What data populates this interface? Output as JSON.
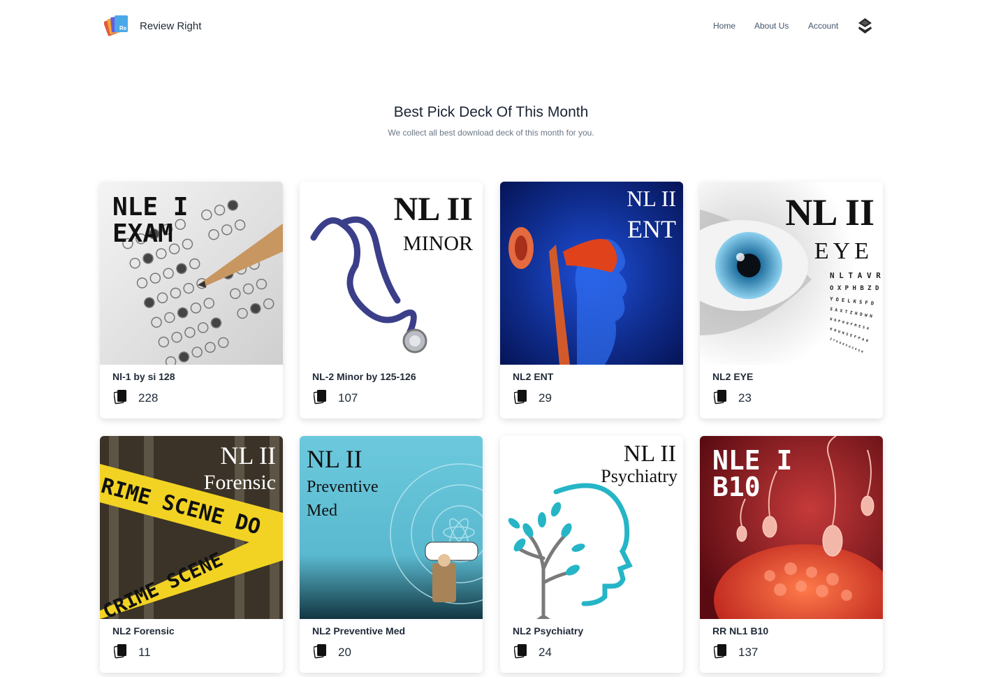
{
  "header": {
    "brand": "Review Right",
    "nav": {
      "home": "Home",
      "about": "About Us",
      "account": "Account"
    }
  },
  "section": {
    "title": "Best Pick Deck Of This Month",
    "subtitle": "We collect all best download deck of this month for you."
  },
  "decks": [
    {
      "title": "Nl-1 by si 128",
      "count": "228",
      "cover": [
        "NLE I",
        "EXAM"
      ]
    },
    {
      "title": "NL-2 Minor by 125-126",
      "count": "107",
      "cover": [
        "NL II",
        "MINOR"
      ]
    },
    {
      "title": "NL2 ENT",
      "count": "29",
      "cover": [
        "NL II",
        "ENT"
      ]
    },
    {
      "title": "NL2 EYE",
      "count": "23",
      "cover": [
        "NL II",
        "EYE"
      ]
    },
    {
      "title": "NL2 Forensic",
      "count": "11",
      "cover": [
        "NL II",
        "Forensic"
      ]
    },
    {
      "title": "NL2 Preventive Med",
      "count": "20",
      "cover": [
        "NL II",
        "Preventive",
        "Med"
      ]
    },
    {
      "title": "NL2 Psychiatry",
      "count": "24",
      "cover": [
        "NL II",
        "Psychiatry"
      ]
    },
    {
      "title": "RR NL1 B10",
      "count": "137",
      "cover": [
        "NLE I",
        "B10"
      ]
    }
  ],
  "colors": {
    "text_dark": "#1f2a37",
    "nav_text": "#44546a",
    "subtitle": "#6b7684",
    "logo_blue": "#4aa8e8"
  },
  "icons": {
    "logo": "review-right-logo",
    "profile": "user-profile-icon",
    "deck": "card-deck-icon"
  }
}
